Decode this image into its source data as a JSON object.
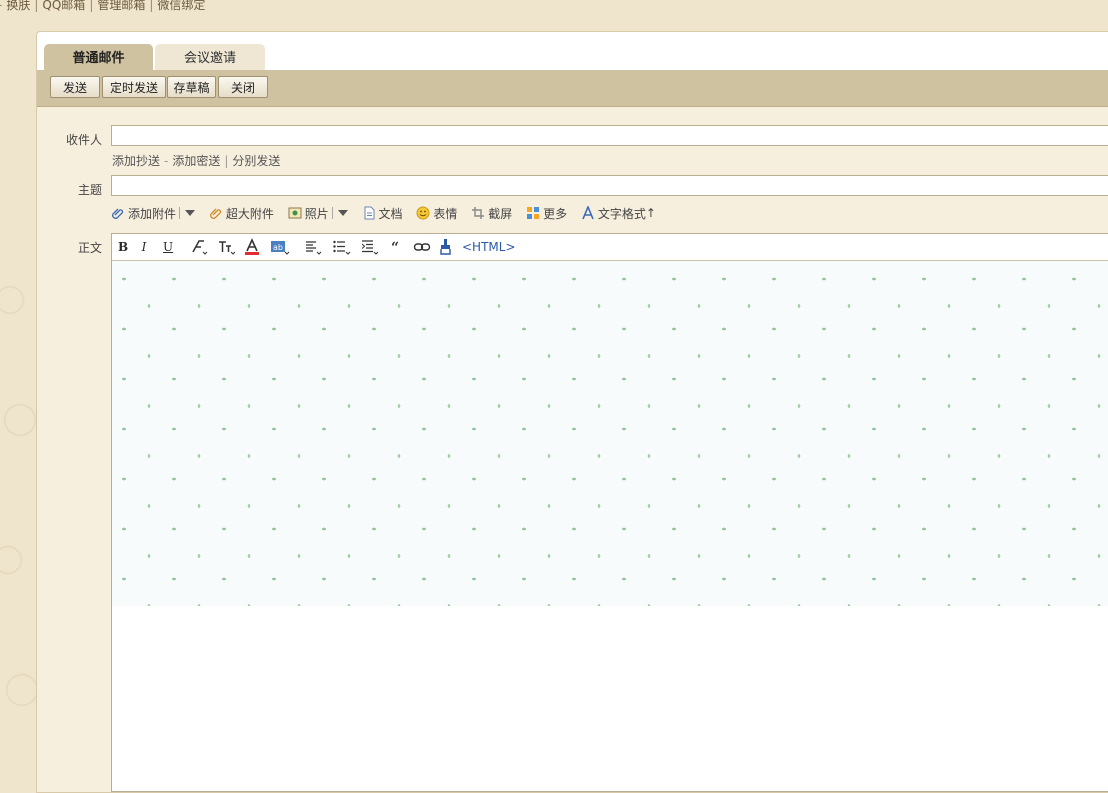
{
  "top_links": [
    "换肤",
    "QQ邮箱",
    "管理邮箱",
    "微信绑定"
  ],
  "tabs": [
    {
      "label": "普通邮件",
      "active": true
    },
    {
      "label": "会议邀请",
      "active": false
    }
  ],
  "toolbar": {
    "send": "发送",
    "scheduled_send": "定时发送",
    "save_draft": "存草稿",
    "close": "关闭"
  },
  "form": {
    "recipient_label": "收件人",
    "recipient_value": "",
    "add_cc": "添加抄送",
    "add_bcc": "添加密送",
    "separate_send": "分别发送",
    "subject_label": "主题",
    "subject_value": "",
    "body_label": "正文"
  },
  "attach_bar": {
    "add_attachment": "添加附件",
    "large_attachment": "超大附件",
    "photo": "照片",
    "document": "文档",
    "emoji": "表情",
    "screenshot": "截屏",
    "more": "更多",
    "text_format": "文字格式",
    "text_format_arrow": "↑"
  },
  "format_bar": {
    "bold": "B",
    "italic": "I",
    "underline": "U",
    "html": "<HTML>"
  },
  "colors": {
    "page_bg": "#efe5cd",
    "tab_active": "#cfc2a0",
    "toolbar": "#cfc2a0",
    "form_bg": "#f7efde",
    "editor_pattern": "#93c39a",
    "link_blue": "#2a5aa8"
  }
}
